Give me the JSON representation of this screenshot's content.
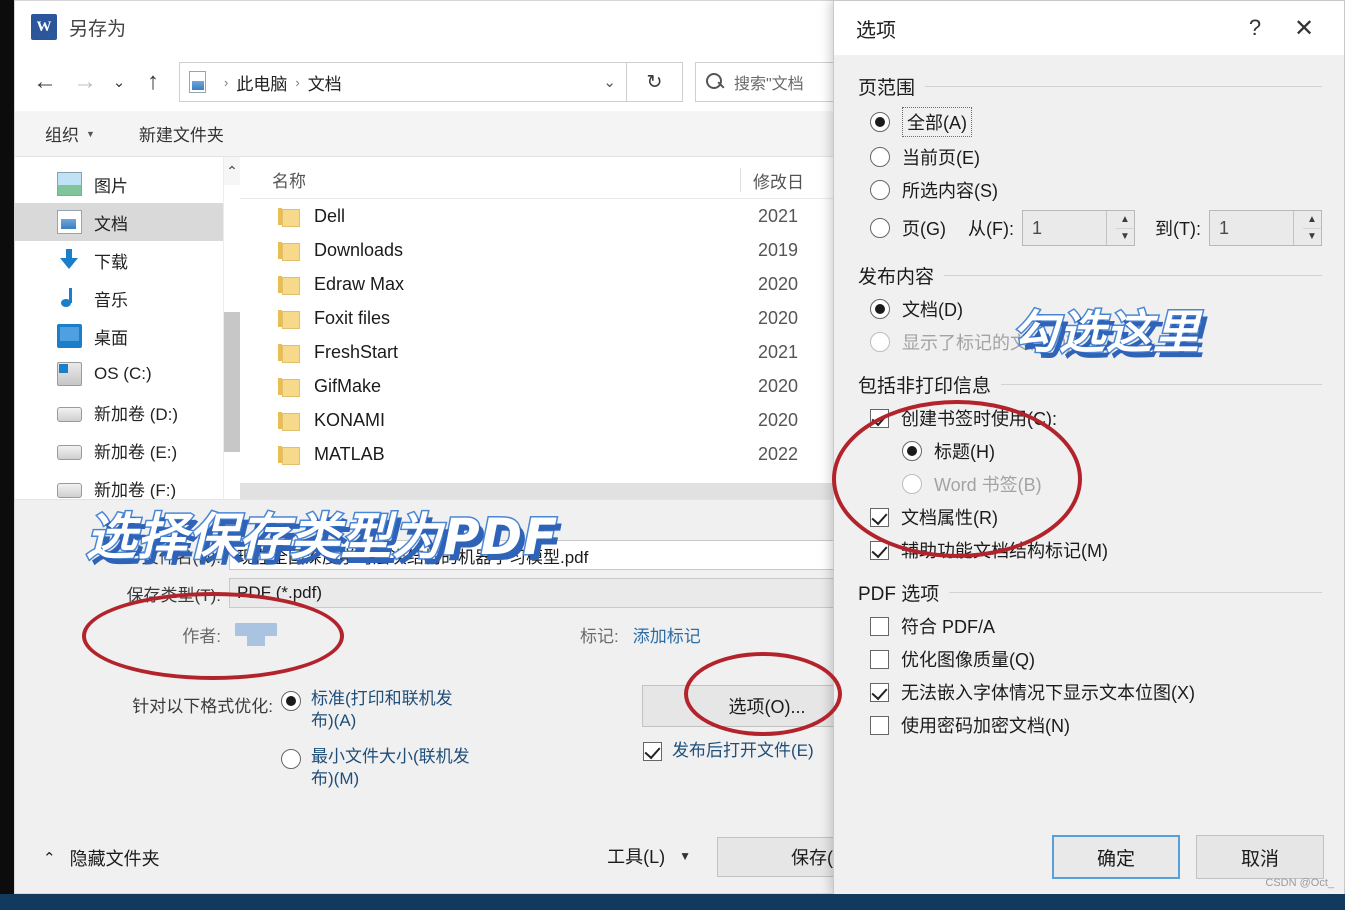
{
  "save_dialog": {
    "title": "另存为",
    "app_icon": "word-icon",
    "nav": {
      "back_icon": "arrow-left-icon",
      "forward_icon": "arrow-right-icon",
      "recent_icon": "chevron-down-icon",
      "up_icon": "arrow-up-icon",
      "breadcrumb": [
        "此电脑",
        "文档"
      ],
      "breadcrumb_separator": "›",
      "address_chevron": "chevron-down-icon",
      "refresh_icon": "refresh-icon",
      "search_icon": "search-icon",
      "search_placeholder": "搜索\"文档"
    },
    "commandbar": {
      "organize": "组织",
      "organize_caret": "▾",
      "new_folder": "新建文件夹"
    },
    "tree": {
      "items": [
        {
          "label": "图片",
          "icon": "pictures-icon",
          "selected": false
        },
        {
          "label": "文档",
          "icon": "documents-icon",
          "selected": true
        },
        {
          "label": "下载",
          "icon": "downloads-icon",
          "selected": false
        },
        {
          "label": "音乐",
          "icon": "music-icon",
          "selected": false
        },
        {
          "label": "桌面",
          "icon": "desktop-icon",
          "selected": false
        },
        {
          "label": "OS (C:)",
          "icon": "os-drive-icon",
          "selected": false
        },
        {
          "label": "新加卷 (D:)",
          "icon": "drive-icon",
          "selected": false
        },
        {
          "label": "新加卷 (E:)",
          "icon": "drive-icon",
          "selected": false
        },
        {
          "label": "新加卷 (F:)",
          "icon": "drive-icon",
          "selected": false
        }
      ],
      "scroll_up_icon": "chevron-up-icon"
    },
    "filelist": {
      "columns": [
        "名称",
        "修改日"
      ],
      "sort_indicator": "chevron-up-icon",
      "rows": [
        {
          "name": "Dell",
          "date": "2021"
        },
        {
          "name": "Downloads",
          "date": "2019"
        },
        {
          "name": "Edraw Max",
          "date": "2020"
        },
        {
          "name": "Foxit files",
          "date": "2020"
        },
        {
          "name": "FreshStart",
          "date": "2021"
        },
        {
          "name": "GifMake",
          "date": "2020"
        },
        {
          "name": "KONAMI",
          "date": "2020"
        },
        {
          "name": "MATLAB",
          "date": "2022"
        }
      ]
    },
    "form": {
      "filename_label": "文件名(N):",
      "filename_value": "现在全国深度学习层次结构的机器学习模型.pdf",
      "savetype_label": "保存类型(T):",
      "savetype_value": "PDF (*.pdf)",
      "author_label": "作者:",
      "author_value": "",
      "tags_label": "标记:",
      "tags_link": "添加标记",
      "optimize_label": "针对以下格式优化:",
      "optimize_options": [
        {
          "label": "标准(打印和联机发布)(A)",
          "selected": true
        },
        {
          "label": "最小文件大小(联机发布)(M)",
          "selected": false
        }
      ],
      "options_button": "选项(O)...",
      "open_after_publish": "发布后打开文件(E)",
      "open_after_publish_checked": true
    },
    "footer": {
      "hide_folders_caret": "⌃",
      "hide_folders": "隐藏文件夹",
      "tools": "工具(L)",
      "tools_caret": "▾",
      "save": "保存(S)"
    }
  },
  "options_dialog": {
    "title": "选项",
    "help_icon": "question-mark-icon",
    "close_icon": "close-icon",
    "groups": {
      "page_range": {
        "title": "页范围",
        "options": [
          {
            "label": "全部(A)",
            "selected": true,
            "focused": true
          },
          {
            "label": "当前页(E)",
            "selected": false
          },
          {
            "label": "所选内容(S)",
            "selected": false
          },
          {
            "label": "页(G)",
            "selected": false
          }
        ],
        "from_label": "从(F):",
        "from_value": "1",
        "to_label": "到(T):",
        "to_value": "1",
        "spin_up_icon": "triangle-up-icon",
        "spin_down_icon": "triangle-down-icon"
      },
      "publish_what": {
        "title": "发布内容",
        "options": [
          {
            "label": "文档(D)",
            "selected": true,
            "disabled": false
          },
          {
            "label": "显示了标记的文档(O)",
            "selected": false,
            "disabled": true
          }
        ]
      },
      "include_nonprint": {
        "title": "包括非打印信息",
        "checkboxes": [
          {
            "label": "创建书签时使用(C):",
            "checked": true
          }
        ],
        "bookmark_sources": [
          {
            "label": "标题(H)",
            "selected": true,
            "disabled": false
          },
          {
            "label": "Word 书签(B)",
            "selected": false,
            "disabled": true
          }
        ],
        "more_checkboxes": [
          {
            "label": "文档属性(R)",
            "checked": true
          },
          {
            "label": "辅助功能文档结构标记(M)",
            "checked": true
          }
        ]
      },
      "pdf_options": {
        "title": "PDF 选项",
        "checkboxes": [
          {
            "label": "符合 PDF/A",
            "checked": false
          },
          {
            "label": "优化图像质量(Q)",
            "checked": false
          },
          {
            "label": "无法嵌入字体情况下显示文本位图(X)",
            "checked": true
          },
          {
            "label": "使用密码加密文档(N)",
            "checked": false
          }
        ]
      }
    },
    "buttons": {
      "ok": "确定",
      "cancel": "取消"
    },
    "watermark": "CSDN @Oct_"
  },
  "annotations": {
    "overlay_pdf": "选择保存类型为PDF",
    "overlay_check": "勾选这里",
    "overlay_fill": "#ffffff",
    "overlay_stroke": "#4a86d6",
    "overlay_shadow": "#2e63b8",
    "circle_color": "#b2232b"
  }
}
